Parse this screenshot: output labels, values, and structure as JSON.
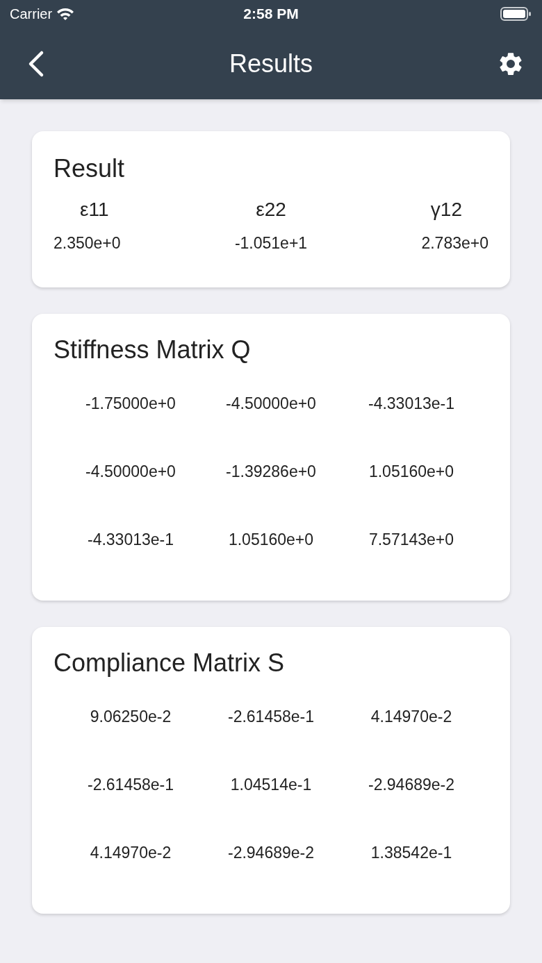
{
  "status_bar": {
    "carrier": "Carrier",
    "time": "2:58 PM"
  },
  "nav": {
    "title": "Results"
  },
  "result": {
    "title": "Result",
    "items": [
      {
        "label": "ε11",
        "value": "2.350e+0"
      },
      {
        "label": "ε22",
        "value": "-1.051e+1"
      },
      {
        "label": "γ12",
        "value": "2.783e+0"
      }
    ]
  },
  "matrices": [
    {
      "title": "Stiffness Matrix Q",
      "rows": [
        [
          "-1.75000e+0",
          "-4.50000e+0",
          "-4.33013e-1"
        ],
        [
          "-4.50000e+0",
          "-1.39286e+0",
          "1.05160e+0"
        ],
        [
          "-4.33013e-1",
          "1.05160e+0",
          "7.57143e+0"
        ]
      ]
    },
    {
      "title": "Compliance Matrix S",
      "rows": [
        [
          "9.06250e-2",
          "-2.61458e-1",
          "4.14970e-2"
        ],
        [
          "-2.61458e-1",
          "1.04514e-1",
          "-2.94689e-2"
        ],
        [
          "4.14970e-2",
          "-2.94689e-2",
          "1.38542e-1"
        ]
      ]
    }
  ]
}
